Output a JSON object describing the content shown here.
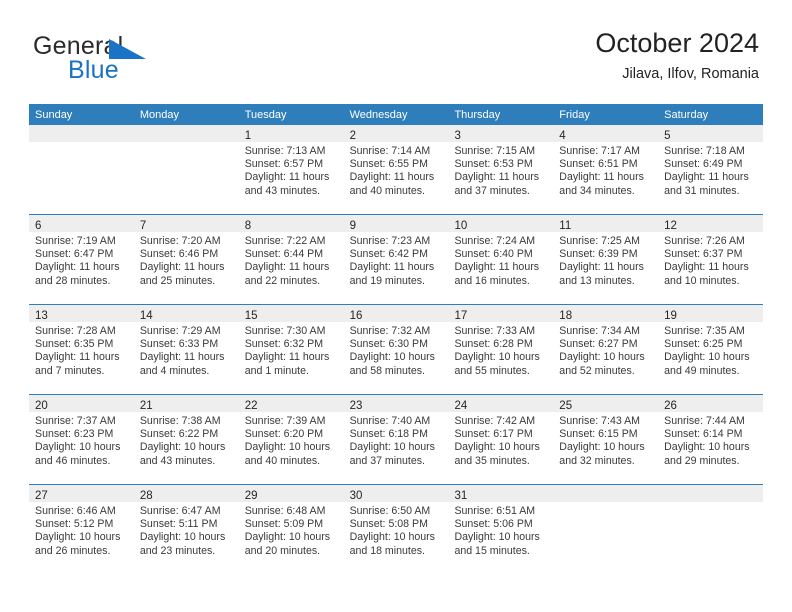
{
  "brand": {
    "name_part1": "General",
    "name_part2": "Blue",
    "accent_color": "#1a73c4"
  },
  "header": {
    "title": "October 2024",
    "location": "Jilava, Ilfov, Romania"
  },
  "calendar": {
    "header_color": "#2e7ebc",
    "weekdays": [
      "Sunday",
      "Monday",
      "Tuesday",
      "Wednesday",
      "Thursday",
      "Friday",
      "Saturday"
    ],
    "weeks": [
      [
        {
          "day": "",
          "lines": []
        },
        {
          "day": "",
          "lines": []
        },
        {
          "day": "1",
          "lines": [
            "Sunrise: 7:13 AM",
            "Sunset: 6:57 PM",
            "Daylight: 11 hours and 43 minutes."
          ]
        },
        {
          "day": "2",
          "lines": [
            "Sunrise: 7:14 AM",
            "Sunset: 6:55 PM",
            "Daylight: 11 hours and 40 minutes."
          ]
        },
        {
          "day": "3",
          "lines": [
            "Sunrise: 7:15 AM",
            "Sunset: 6:53 PM",
            "Daylight: 11 hours and 37 minutes."
          ]
        },
        {
          "day": "4",
          "lines": [
            "Sunrise: 7:17 AM",
            "Sunset: 6:51 PM",
            "Daylight: 11 hours and 34 minutes."
          ]
        },
        {
          "day": "5",
          "lines": [
            "Sunrise: 7:18 AM",
            "Sunset: 6:49 PM",
            "Daylight: 11 hours and 31 minutes."
          ]
        }
      ],
      [
        {
          "day": "6",
          "lines": [
            "Sunrise: 7:19 AM",
            "Sunset: 6:47 PM",
            "Daylight: 11 hours and 28 minutes."
          ]
        },
        {
          "day": "7",
          "lines": [
            "Sunrise: 7:20 AM",
            "Sunset: 6:46 PM",
            "Daylight: 11 hours and 25 minutes."
          ]
        },
        {
          "day": "8",
          "lines": [
            "Sunrise: 7:22 AM",
            "Sunset: 6:44 PM",
            "Daylight: 11 hours and 22 minutes."
          ]
        },
        {
          "day": "9",
          "lines": [
            "Sunrise: 7:23 AM",
            "Sunset: 6:42 PM",
            "Daylight: 11 hours and 19 minutes."
          ]
        },
        {
          "day": "10",
          "lines": [
            "Sunrise: 7:24 AM",
            "Sunset: 6:40 PM",
            "Daylight: 11 hours and 16 minutes."
          ]
        },
        {
          "day": "11",
          "lines": [
            "Sunrise: 7:25 AM",
            "Sunset: 6:39 PM",
            "Daylight: 11 hours and 13 minutes."
          ]
        },
        {
          "day": "12",
          "lines": [
            "Sunrise: 7:26 AM",
            "Sunset: 6:37 PM",
            "Daylight: 11 hours and 10 minutes."
          ]
        }
      ],
      [
        {
          "day": "13",
          "lines": [
            "Sunrise: 7:28 AM",
            "Sunset: 6:35 PM",
            "Daylight: 11 hours and 7 minutes."
          ]
        },
        {
          "day": "14",
          "lines": [
            "Sunrise: 7:29 AM",
            "Sunset: 6:33 PM",
            "Daylight: 11 hours and 4 minutes."
          ]
        },
        {
          "day": "15",
          "lines": [
            "Sunrise: 7:30 AM",
            "Sunset: 6:32 PM",
            "Daylight: 11 hours and 1 minute."
          ]
        },
        {
          "day": "16",
          "lines": [
            "Sunrise: 7:32 AM",
            "Sunset: 6:30 PM",
            "Daylight: 10 hours and 58 minutes."
          ]
        },
        {
          "day": "17",
          "lines": [
            "Sunrise: 7:33 AM",
            "Sunset: 6:28 PM",
            "Daylight: 10 hours and 55 minutes."
          ]
        },
        {
          "day": "18",
          "lines": [
            "Sunrise: 7:34 AM",
            "Sunset: 6:27 PM",
            "Daylight: 10 hours and 52 minutes."
          ]
        },
        {
          "day": "19",
          "lines": [
            "Sunrise: 7:35 AM",
            "Sunset: 6:25 PM",
            "Daylight: 10 hours and 49 minutes."
          ]
        }
      ],
      [
        {
          "day": "20",
          "lines": [
            "Sunrise: 7:37 AM",
            "Sunset: 6:23 PM",
            "Daylight: 10 hours and 46 minutes."
          ]
        },
        {
          "day": "21",
          "lines": [
            "Sunrise: 7:38 AM",
            "Sunset: 6:22 PM",
            "Daylight: 10 hours and 43 minutes."
          ]
        },
        {
          "day": "22",
          "lines": [
            "Sunrise: 7:39 AM",
            "Sunset: 6:20 PM",
            "Daylight: 10 hours and 40 minutes."
          ]
        },
        {
          "day": "23",
          "lines": [
            "Sunrise: 7:40 AM",
            "Sunset: 6:18 PM",
            "Daylight: 10 hours and 37 minutes."
          ]
        },
        {
          "day": "24",
          "lines": [
            "Sunrise: 7:42 AM",
            "Sunset: 6:17 PM",
            "Daylight: 10 hours and 35 minutes."
          ]
        },
        {
          "day": "25",
          "lines": [
            "Sunrise: 7:43 AM",
            "Sunset: 6:15 PM",
            "Daylight: 10 hours and 32 minutes."
          ]
        },
        {
          "day": "26",
          "lines": [
            "Sunrise: 7:44 AM",
            "Sunset: 6:14 PM",
            "Daylight: 10 hours and 29 minutes."
          ]
        }
      ],
      [
        {
          "day": "27",
          "lines": [
            "Sunrise: 6:46 AM",
            "Sunset: 5:12 PM",
            "Daylight: 10 hours and 26 minutes."
          ]
        },
        {
          "day": "28",
          "lines": [
            "Sunrise: 6:47 AM",
            "Sunset: 5:11 PM",
            "Daylight: 10 hours and 23 minutes."
          ]
        },
        {
          "day": "29",
          "lines": [
            "Sunrise: 6:48 AM",
            "Sunset: 5:09 PM",
            "Daylight: 10 hours and 20 minutes."
          ]
        },
        {
          "day": "30",
          "lines": [
            "Sunrise: 6:50 AM",
            "Sunset: 5:08 PM",
            "Daylight: 10 hours and 18 minutes."
          ]
        },
        {
          "day": "31",
          "lines": [
            "Sunrise: 6:51 AM",
            "Sunset: 5:06 PM",
            "Daylight: 10 hours and 15 minutes."
          ]
        },
        {
          "day": "",
          "lines": []
        },
        {
          "day": "",
          "lines": []
        }
      ]
    ]
  }
}
